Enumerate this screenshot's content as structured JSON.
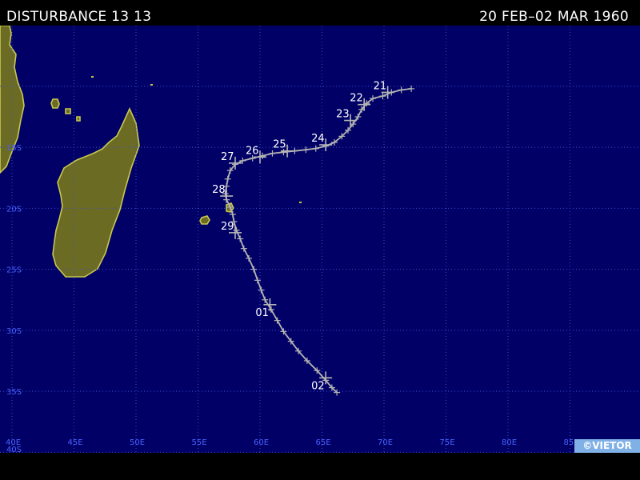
{
  "header": {
    "title": "DISTURBANCE 13 13",
    "dates": "20 FEB–02 MAR 1960"
  },
  "credit": "©VIETOR",
  "colors": {
    "ocean": "#000066",
    "land": "#6b6b23",
    "coast": "#c8c850",
    "grid": "#3a4fd0",
    "grid_labels": "#4a62ff",
    "track": "#b4b4b4",
    "labels": "#ffffff"
  },
  "map": {
    "lon_labels": [
      "40E",
      "45E",
      "50E",
      "55E",
      "60E",
      "65E",
      "70E",
      "75E",
      "80E",
      "85E"
    ],
    "lat_labels": [
      "15S",
      "20S",
      "25S",
      "30S",
      "35S",
      "40S"
    ]
  },
  "track": {
    "points": [
      [
        72.2,
        -10.2
      ],
      [
        71.4,
        -10.3
      ],
      [
        70.6,
        -10.5
      ],
      [
        69.9,
        -10.8
      ],
      [
        69.1,
        -11.0
      ],
      [
        68.6,
        -11.4
      ],
      [
        68.2,
        -11.9
      ],
      [
        67.9,
        -12.5
      ],
      [
        67.5,
        -13.1
      ],
      [
        67.1,
        -13.6
      ],
      [
        66.6,
        -14.1
      ],
      [
        66.0,
        -14.6
      ],
      [
        65.3,
        -14.9
      ],
      [
        64.5,
        -15.1
      ],
      [
        63.7,
        -15.2
      ],
      [
        62.8,
        -15.3
      ],
      [
        61.9,
        -15.4
      ],
      [
        61.0,
        -15.5
      ],
      [
        60.2,
        -15.7
      ],
      [
        59.4,
        -15.9
      ],
      [
        58.6,
        -16.1
      ],
      [
        58.0,
        -16.4
      ],
      [
        57.6,
        -16.9
      ],
      [
        57.4,
        -17.6
      ],
      [
        57.3,
        -18.2
      ],
      [
        57.2,
        -18.8
      ],
      [
        57.3,
        -19.3
      ],
      [
        57.6,
        -19.9
      ],
      [
        57.8,
        -20.5
      ],
      [
        57.9,
        -21.1
      ],
      [
        58.1,
        -21.8
      ],
      [
        58.4,
        -22.5
      ],
      [
        58.7,
        -23.3
      ],
      [
        59.1,
        -24.1
      ],
      [
        59.5,
        -25.0
      ],
      [
        59.8,
        -25.9
      ],
      [
        60.1,
        -26.7
      ],
      [
        60.4,
        -27.5
      ],
      [
        60.9,
        -28.3
      ],
      [
        61.4,
        -29.2
      ],
      [
        61.9,
        -30.1
      ],
      [
        62.5,
        -30.9
      ],
      [
        63.1,
        -31.7
      ],
      [
        63.8,
        -32.5
      ],
      [
        64.6,
        -33.3
      ],
      [
        65.3,
        -34.1
      ],
      [
        65.8,
        -34.7
      ],
      [
        66.2,
        -35.1
      ]
    ],
    "day_labels": [
      {
        "day": "21",
        "lon": 70.3,
        "lat": -10.5
      },
      {
        "day": "22",
        "lon": 68.4,
        "lat": -11.5
      },
      {
        "day": "23",
        "lon": 67.3,
        "lat": -12.8
      },
      {
        "day": "24",
        "lon": 65.3,
        "lat": -14.8
      },
      {
        "day": "25",
        "lon": 62.2,
        "lat": -15.3
      },
      {
        "day": "26",
        "lon": 60.0,
        "lat": -15.8
      },
      {
        "day": "27",
        "lon": 58.0,
        "lat": -16.3
      },
      {
        "day": "28",
        "lon": 57.3,
        "lat": -19.0
      },
      {
        "day": "29",
        "lon": 58.0,
        "lat": -22.0
      },
      {
        "day": "01",
        "lon": 60.8,
        "lat": -27.9
      },
      {
        "day": "02",
        "lon": 65.3,
        "lat": -33.9
      }
    ]
  }
}
